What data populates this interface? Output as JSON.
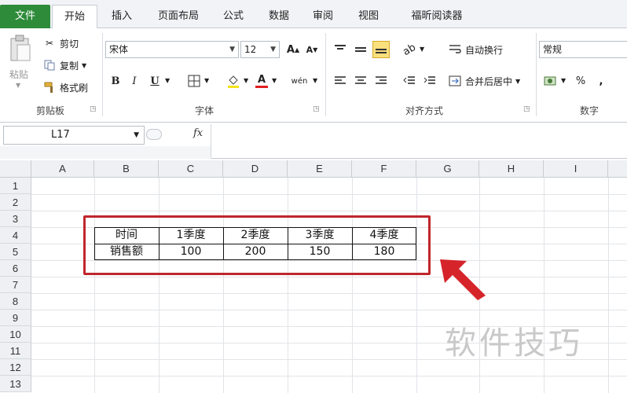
{
  "tabs": [
    "文件",
    "开始",
    "插入",
    "页面布局",
    "公式",
    "数据",
    "审阅",
    "视图",
    "福昕阅读器"
  ],
  "clipboard": {
    "paste": "粘贴",
    "cut": "剪切",
    "copy": "复制",
    "format_painter": "格式刷",
    "group_label": "剪贴板"
  },
  "font": {
    "name": "宋体",
    "size": "12",
    "grow": "A",
    "shrink": "A",
    "bold": "B",
    "italic": "I",
    "underline": "U",
    "font_color_letter": "A",
    "phonetic": "wén",
    "group_label": "字体"
  },
  "alignment": {
    "wrap_text": "自动换行",
    "merge_center": "合并后居中",
    "group_label": "对齐方式"
  },
  "number": {
    "format": "常规",
    "percent": "%",
    "comma": ",",
    "group_label": "数字"
  },
  "formula_bar": {
    "name_box": "L17",
    "fx": "fx",
    "formula": ""
  },
  "columns": [
    "A",
    "B",
    "C",
    "D",
    "E",
    "F",
    "G",
    "H",
    "I"
  ],
  "rows": [
    "1",
    "2",
    "3",
    "4",
    "5",
    "6",
    "7",
    "8",
    "9",
    "10",
    "11",
    "12",
    "13"
  ],
  "table": {
    "header": [
      "时间",
      "1季度",
      "2季度",
      "3季度",
      "4季度"
    ],
    "data": [
      "销售额",
      "100",
      "200",
      "150",
      "180"
    ]
  },
  "watermark": "软件技巧",
  "colors": {
    "file_tab": "#2e8b3a",
    "highlight": "#c0262d",
    "active_align": "#fbe07e"
  }
}
